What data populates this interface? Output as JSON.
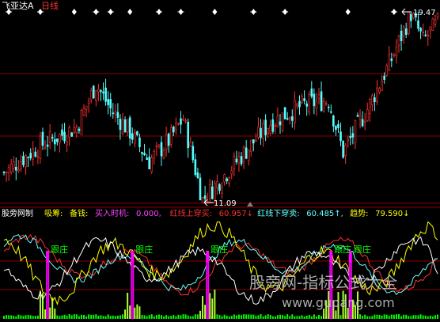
{
  "header": {
    "symbol": "飞亚达A",
    "period": "日线"
  },
  "price_panel": {
    "high_label": "19.47",
    "low_label": "11.09"
  },
  "indicator_panel": {
    "name": "股旁网制",
    "items": [
      {
        "label": "吸筹:",
        "value": "",
        "color": "#ffff00"
      },
      {
        "label": "备钱:",
        "value": "",
        "color": "#ffff00"
      },
      {
        "label": "买入时机:",
        "value": "0.000,",
        "color": "#ff44ff"
      },
      {
        "label": "红线上穿买:",
        "value": "60.957↓",
        "color": "#ff3030"
      },
      {
        "label": "红线下穿卖:",
        "value": "60.485↑,",
        "color": "#66ffff"
      },
      {
        "label": "趋势:",
        "value": "79.590↓",
        "color": "#ffff00"
      }
    ],
    "signal_labels": [
      {
        "text": "跟庄"
      },
      {
        "text": "跟庄"
      },
      {
        "text": "跟庄"
      },
      {
        "text": "跟庄"
      },
      {
        "text": "跟庄"
      }
    ]
  },
  "watermark": {
    "line1": "股旁网-指标公式大全",
    "line2": "www.gupang.com"
  },
  "colors": {
    "up": "#ff3030",
    "down": "#54ffff",
    "grid": "#8b0000",
    "signal": "#ff00ff",
    "volume": "#00ff00",
    "trend": "#ffffff"
  },
  "chart_data": [
    {
      "type": "candlestick",
      "title": "飞亚达A 日线",
      "n_bars": 180,
      "highest": 19.47,
      "lowest": 11.09,
      "close_path": [
        {
          "bar": 0,
          "price": 12.4
        },
        {
          "bar": 15,
          "price": 13.6
        },
        {
          "bar": 30,
          "price": 14.4
        },
        {
          "bar": 38,
          "price": 16.3
        },
        {
          "bar": 44,
          "price": 15.2
        },
        {
          "bar": 52,
          "price": 14.2
        },
        {
          "bar": 60,
          "price": 12.9
        },
        {
          "bar": 68,
          "price": 13.8
        },
        {
          "bar": 74,
          "price": 14.8
        },
        {
          "bar": 82,
          "price": 11.2
        },
        {
          "bar": 96,
          "price": 12.9
        },
        {
          "bar": 110,
          "price": 14.6
        },
        {
          "bar": 124,
          "price": 15.4
        },
        {
          "bar": 134,
          "price": 15.6
        },
        {
          "bar": 140,
          "price": 13.3
        },
        {
          "bar": 150,
          "price": 15.2
        },
        {
          "bar": 160,
          "price": 17.4
        },
        {
          "bar": 168,
          "price": 19.4
        },
        {
          "bar": 173,
          "price": 18.2
        },
        {
          "bar": 179,
          "price": 19.0
        }
      ],
      "event_markers_bars": [
        2,
        15,
        29,
        38,
        44,
        52,
        64,
        73,
        87,
        103,
        116,
        142,
        161
      ]
    },
    {
      "type": "line",
      "title": "股旁网制",
      "ylim": [
        0,
        100
      ],
      "series": [
        {
          "name": "红线上穿买",
          "color": "#ff3030",
          "last": 60.957
        },
        {
          "name": "红线下穿卖",
          "color": "#66ffff",
          "last": 60.485
        },
        {
          "name": "趋势",
          "color": "#ffff00",
          "last": 79.59
        }
      ],
      "signal_bars": [
        18,
        53,
        84,
        135,
        143
      ]
    }
  ]
}
